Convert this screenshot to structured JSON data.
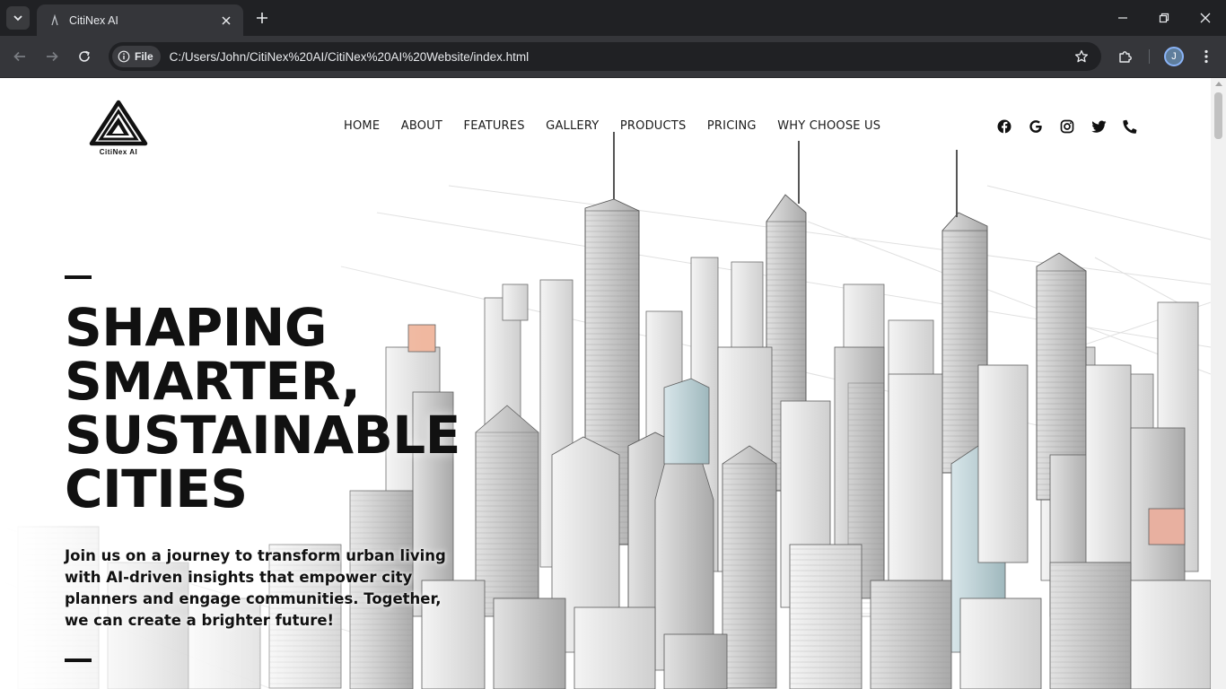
{
  "browser": {
    "tab_title": "CitiNex AI",
    "address_chip": "File",
    "url": "C:/Users/John/CitiNex%20AI/CitiNex%20AI%20Website/index.html",
    "profile_initial": "J"
  },
  "site": {
    "logo_text": "CitiNex AI",
    "nav": [
      "HOME",
      "ABOUT",
      "FEATURES",
      "GALLERY",
      "PRODUCTS",
      "PRICING",
      "WHY CHOOSE US"
    ],
    "social_icons": [
      "facebook-icon",
      "google-icon",
      "instagram-icon",
      "twitter-icon",
      "phone-icon"
    ]
  },
  "hero": {
    "title_lines": [
      "SHAPING",
      "SMARTER,",
      "SUSTAINABLE",
      "CITIES"
    ],
    "subtitle": "Join us on a journey to transform urban living with AI-driven insights that empower city planners and engage communities. Together, we can create a brighter future!"
  },
  "colors": {
    "chrome_dark": "#202124",
    "chrome_toolbar": "#35363a",
    "text_primary": "#111111",
    "page_bg": "#ffffff"
  }
}
